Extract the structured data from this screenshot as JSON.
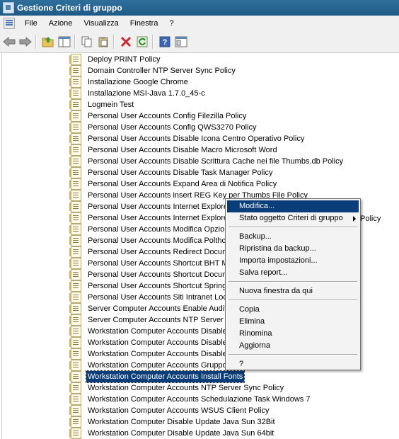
{
  "window": {
    "title": "Gestione Criteri di gruppo"
  },
  "menubar": {
    "items": [
      "File",
      "Azione",
      "Visualizza",
      "Finestra",
      "?"
    ]
  },
  "toolbar": {
    "buttons": [
      {
        "name": "back-icon"
      },
      {
        "name": "forward-icon"
      },
      {
        "name": "up-folder-icon"
      },
      {
        "name": "show-tree-icon"
      },
      {
        "name": "copy-icon"
      },
      {
        "name": "paste-icon"
      },
      {
        "name": "delete-icon"
      },
      {
        "name": "refresh-icon"
      },
      {
        "name": "help-icon"
      },
      {
        "name": "properties-icon"
      }
    ]
  },
  "tree": {
    "selected_index": 28,
    "items": [
      "Deploy PRINT Policy",
      "Domain Controller NTP Server Sync Policy",
      "Installazione Google Chrome",
      "Installazione MSI-Java 1.7.0_45-c",
      "Logmein Test",
      "Personal User Accounts Config Filezilla Policy",
      "Personal User Accounts Config QWS3270 Policy",
      "Personal User Accounts Disable Icona Centro Operativo Policy",
      "Personal User Accounts Disable Macro Microsoft Word",
      "Personal User Accounts Disable Scrittura Cache nei file Thumbs.db Policy",
      "Personal User Accounts Disable Task Manager Policy",
      "Personal User Accounts Expand Area di Notifica Policy",
      "Personal User Accounts insert REG Key per Thumbs File Policy",
      "Personal User Accounts Internet Explorer",
      "Personal User Accounts Internet Explorer",
      "Personal User Accounts Modifica Opzioni",
      "Personal User Accounts Modifica Polthce",
      "Personal User Accounts Redirect Docume",
      "Personal User Accounts Shortcut BHT Mar",
      "Personal User Accounts Shortcut Docume",
      "Personal User Accounts Shortcut Spring F",
      "Personal User Accounts Siti Intranet Loca",
      "Server Computer Accounts Enable Audits",
      "Server Computer Accounts NTP Server Sy",
      "Workstation Computer Accounts Disable F",
      "Workstation Computer Accounts Disable I",
      "Workstation Computer Accounts Disable C",
      "Workstation Computer Accounts Gruppo A",
      "Workstation Computer Accounts Install Fonts",
      "Workstation Computer Accounts NTP Server Sync Policy",
      "Workstation Computer Accounts Schedulazione Task Windows 7",
      "Workstation Computer Accounts WSUS Client Policy",
      "Workstation Computer Disable Update Java Sun 32Bit",
      "Workstation Computer Disable Update Java Sun 64bit"
    ]
  },
  "context_menu": {
    "items": [
      {
        "label": "Modifica...",
        "highlighted": true
      },
      {
        "label": "Stato oggetto Criteri di gruppo",
        "submenu": true
      },
      {
        "separator": true
      },
      {
        "label": "Backup..."
      },
      {
        "label": "Ripristina da backup..."
      },
      {
        "label": "Importa impostazioni..."
      },
      {
        "label": "Salva report..."
      },
      {
        "separator": true
      },
      {
        "label": "Nuova finestra da qui"
      },
      {
        "separator": true
      },
      {
        "label": "Copia"
      },
      {
        "label": "Elimina"
      },
      {
        "label": "Rinomina"
      },
      {
        "label": "Aggiorna"
      },
      {
        "separator": true
      },
      {
        "label": "?"
      }
    ],
    "overflow_text": "Policy"
  }
}
